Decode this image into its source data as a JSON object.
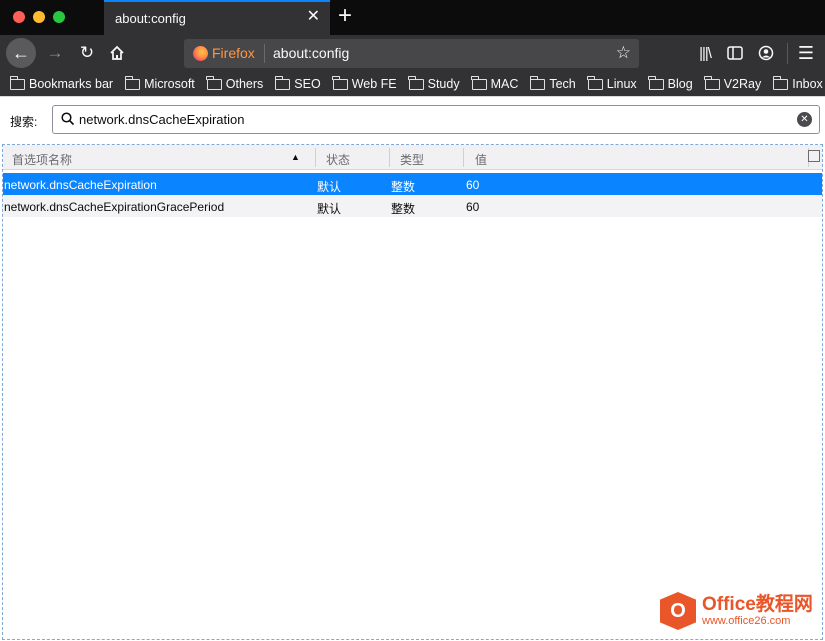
{
  "tab": {
    "title": "about:config"
  },
  "urlbar": {
    "identity_label": "Firefox",
    "url": "about:config"
  },
  "bookmarks": [
    {
      "label": "Bookmarks bar"
    },
    {
      "label": "Microsoft"
    },
    {
      "label": "Others"
    },
    {
      "label": "SEO"
    },
    {
      "label": "Web FE"
    },
    {
      "label": "Study"
    },
    {
      "label": "MAC"
    },
    {
      "label": "Tech"
    },
    {
      "label": "Linux"
    },
    {
      "label": "Blog"
    },
    {
      "label": "V2Ray"
    },
    {
      "label": "Inbox"
    }
  ],
  "search": {
    "label": "搜索:",
    "value": "network.dnsCacheExpiration"
  },
  "table": {
    "headers": {
      "name": "首选项名称",
      "status": "状态",
      "type": "类型",
      "value": "值"
    },
    "rows": [
      {
        "name": "network.dnsCacheExpiration",
        "status": "默认",
        "type": "整数",
        "value": "60",
        "selected": true
      },
      {
        "name": "network.dnsCacheExpirationGracePeriod",
        "status": "默认",
        "type": "整数",
        "value": "60",
        "selected": false
      }
    ]
  },
  "watermark": {
    "brand": "Office教程网",
    "url": "www.office26.com"
  },
  "colors": {
    "accent": "#0a84ff",
    "toolbar": "#323234",
    "tabstrip": "#0c0c0d"
  }
}
